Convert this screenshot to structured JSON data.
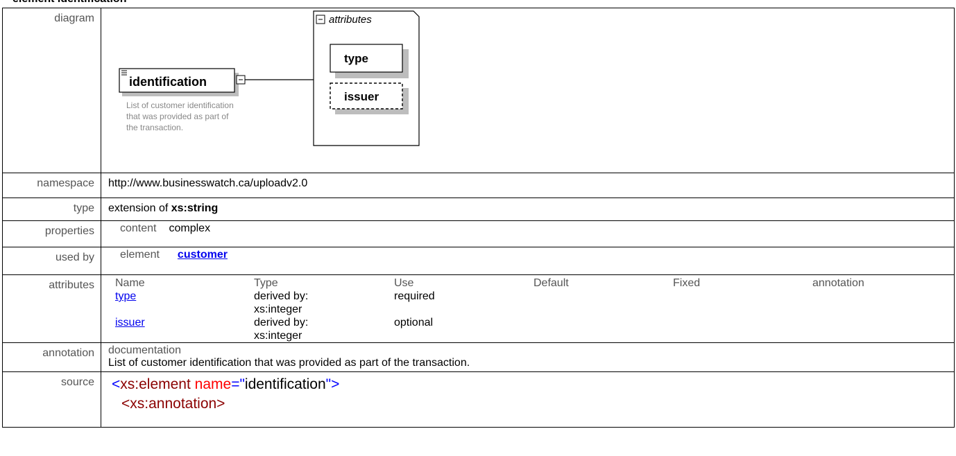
{
  "title": "element identification",
  "diagram": {
    "element_name": "identification",
    "element_doc": [
      "List of customer identification",
      "that was provided as part of",
      "the transaction."
    ],
    "attributes_label": "attributes",
    "attr_type": "type",
    "attr_issuer": "issuer"
  },
  "rows": {
    "diagram_label": "diagram",
    "namespace_label": "namespace",
    "namespace_value": "http://www.businesswatch.ca/uploadv2.0",
    "type_label": "type",
    "type_prefix": "extension of",
    "type_value": "xs:string",
    "properties_label": "properties",
    "properties_key": "content",
    "properties_value": "complex",
    "usedby_label": "used by",
    "usedby_key": "element",
    "usedby_value": "customer",
    "attributes_label": "attributes",
    "annotation_label": "annotation",
    "annotation_key": "documentation",
    "annotation_value": "List of customer identification that was provided as part of the transaction.",
    "source_label": "source"
  },
  "attributes_table": {
    "headers": [
      "Name",
      "Type",
      "Use",
      "Default",
      "Fixed",
      "annotation"
    ],
    "rows": [
      {
        "name": "type",
        "type1": "derived by:",
        "type2": "xs:integer",
        "use": "required"
      },
      {
        "name": "issuer",
        "type1": "derived by:",
        "type2": "xs:integer",
        "use": "optional"
      }
    ]
  },
  "source": {
    "line1_open": "<",
    "line1_tag": "xs:element",
    "line1_attr": "name",
    "line1_eq": "=\"",
    "line1_val": "identification",
    "line1_close": "\">",
    "line2": "<xs:annotation>"
  }
}
